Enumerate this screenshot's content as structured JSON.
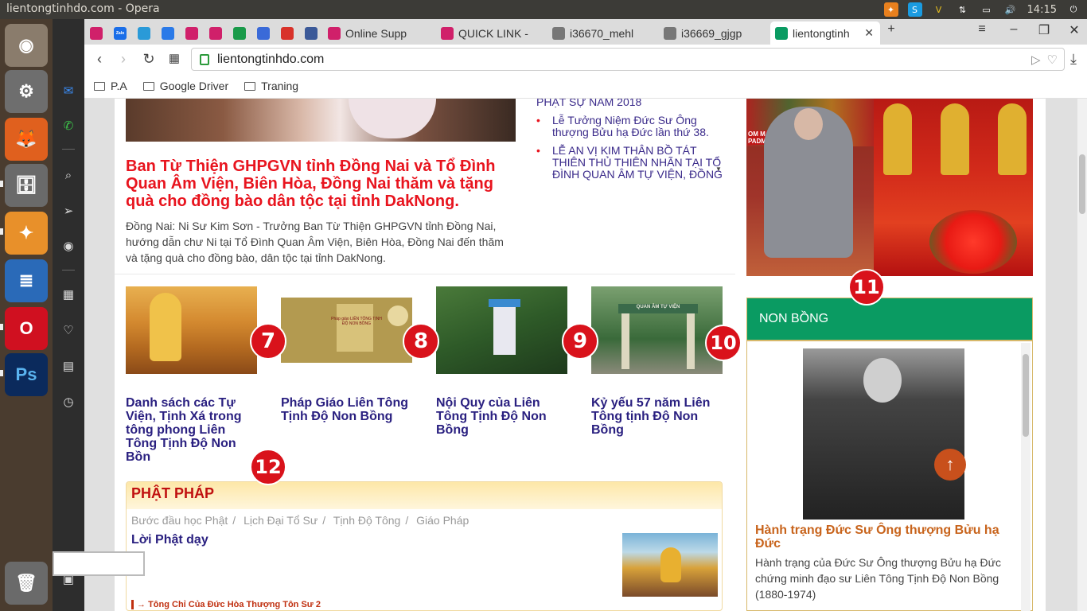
{
  "os": {
    "window_title": "lientongtinhdo.com - Opera",
    "clock": "14:15"
  },
  "browser": {
    "tabs": [
      {
        "label": "",
        "icon": "favicon-site"
      },
      {
        "label": "",
        "icon": "favicon-zalo",
        "icon_text": "Zalo"
      },
      {
        "label": "",
        "icon": "favicon-telegram"
      },
      {
        "label": "",
        "icon": "favicon-messages"
      },
      {
        "label": "",
        "icon": "favicon-site"
      },
      {
        "label": "",
        "icon": "favicon-site"
      },
      {
        "label": "",
        "icon": "favicon-sheets"
      },
      {
        "label": "",
        "icon": "favicon-translate"
      },
      {
        "label": "",
        "icon": "favicon-gmail"
      },
      {
        "label": "",
        "icon": "favicon-facebook"
      },
      {
        "label": "Online Supp",
        "icon": "favicon-site"
      },
      {
        "label": "QUICK LINK -",
        "icon": "favicon-site"
      },
      {
        "label": "i36670_mehl",
        "icon": "favicon-document"
      },
      {
        "label": "i36669_gjgp",
        "icon": "favicon-document"
      },
      {
        "label": "lientongtinh",
        "icon": "favicon-site-active"
      }
    ],
    "url": "lientongtinhdo.com",
    "bookmarks": [
      "P.A",
      "Google Driver",
      "Traning"
    ]
  },
  "page": {
    "hero": {
      "headline": "Ban Từ Thiện GHPGVN tỉnh Đồng Nai và Tổ Đình Quan Âm Viện, Biên Hòa, Đồng Nai thăm và tặng quà cho đồng bào dân tộc tại tỉnh DakNong.",
      "excerpt": "Đồng Nai: Ni Sư Kim Sơn - Trưởng Ban Từ Thiện GHPGVN tỉnh Đồng Nai, hướng dẫn chư Ni tại Tổ Đình Quan Âm Viện, Biên Hòa, Đồng Nai đến thăm và tặng quà cho đồng bào, dân tộc tại tỉnh DakNong."
    },
    "news": {
      "cut_item": "PHẬT SỰ NĂM 2018",
      "items": [
        "Lễ Tưởng Niệm Đức Sư Ông thượng Bửu hạ Đức lần thứ 38.",
        "LỄ AN VỊ KIM THÂN BỒ TÁT THIÊN THỦ THIÊN NHÃN TẠI TỔ ĐÌNH QUAN ÂM TỰ VIỆN, ĐỒNG"
      ]
    },
    "cards": [
      {
        "title": "Danh sách các Tự Viện, Tịnh Xá trong tông phong Liên Tông Tịnh Độ Non Bồn",
        "badge": "7"
      },
      {
        "title": "Pháp Giáo Liên Tông Tịnh Độ Non Bồng",
        "badge": "8",
        "img_caption": "Pháp giáo LIÊN TÔNG TỊNH ĐỘ NON BỒNG"
      },
      {
        "title": "Nội Quy của Liên Tông Tịnh Độ Non Bồng",
        "badge": "9"
      },
      {
        "title": "Kỷ yếu 57 năm Liên Tông tịnh Độ Non Bồng",
        "badge": "10",
        "img_caption": "QUAN ÂM TỰ VIỆN"
      }
    ],
    "badges": {
      "b11": "11",
      "b12": "12"
    },
    "phat_phap": {
      "heading": "PHẬT PHÁP",
      "nav": [
        "Bước đầu học Phật",
        "Lịch Đại Tổ Sư",
        "Tịnh Độ Tông",
        "Giáo Pháp"
      ],
      "title": "Lời Phật dạy",
      "link": "Tông Chỉ Của Đức Hòa Thượng Tôn Sư 2"
    },
    "non_bong": {
      "heading": "NON BỒNG",
      "article_title": "Hành trạng Đức Sư Ông thượng Bửu hạ Đức",
      "article_desc": "Hành trạng của Đức Sư Ông thượng Bửu hạ Đức chứng minh đạo sư Liên Tông Tịnh Độ Non Bồng (1880-1974)"
    },
    "image_text": {
      "banner_text": "OM MA NI PADME HUM"
    }
  },
  "colors": {
    "headline": "#e8141e",
    "link": "#2a2080",
    "badge": "#d9121b",
    "section_green": "#0a9b62",
    "accent_orange": "#c8641c"
  }
}
